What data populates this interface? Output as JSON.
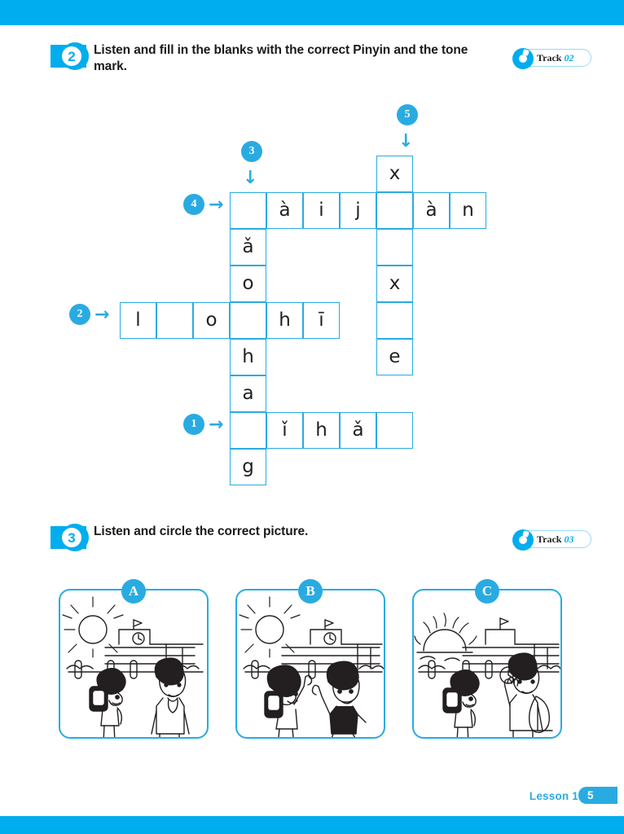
{
  "page": {
    "accent_color": "#00ADEE",
    "grid_border_color": "#29ABE2",
    "top_bar": "",
    "bottom_bar": ""
  },
  "sections": [
    {
      "number": "2",
      "title": "Listen and fill in the blanks with the correct Pinyin and the tone mark.",
      "track": {
        "label": "Track",
        "number": "02",
        "icon": "cd-disc-icon"
      }
    },
    {
      "number": "3",
      "title": "Listen and circle the correct picture.",
      "track": {
        "label": "Track",
        "number": "03",
        "icon": "cd-disc-icon"
      }
    }
  ],
  "crossword": {
    "cell_size": 45,
    "clues": [
      {
        "number": "1",
        "direction": "across",
        "arrow": "→"
      },
      {
        "number": "2",
        "direction": "across",
        "arrow": "→"
      },
      {
        "number": "3",
        "direction": "down",
        "arrow": "↓"
      },
      {
        "number": "4",
        "direction": "across",
        "arrow": "→"
      },
      {
        "number": "5",
        "direction": "down",
        "arrow": "↓"
      }
    ],
    "cells": [
      {
        "col": 7,
        "row": 0,
        "letter": "x"
      },
      {
        "col": 3,
        "row": 1,
        "letter": ""
      },
      {
        "col": 4,
        "row": 1,
        "letter": "à"
      },
      {
        "col": 5,
        "row": 1,
        "letter": "i"
      },
      {
        "col": 6,
        "row": 1,
        "letter": "j"
      },
      {
        "col": 7,
        "row": 1,
        "letter": ""
      },
      {
        "col": 8,
        "row": 1,
        "letter": "à"
      },
      {
        "col": 9,
        "row": 1,
        "letter": "n"
      },
      {
        "col": 3,
        "row": 2,
        "letter": "ǎ"
      },
      {
        "col": 7,
        "row": 2,
        "letter": ""
      },
      {
        "col": 3,
        "row": 3,
        "letter": "o"
      },
      {
        "col": 7,
        "row": 3,
        "letter": "x"
      },
      {
        "col": 0,
        "row": 4,
        "letter": "l"
      },
      {
        "col": 1,
        "row": 4,
        "letter": ""
      },
      {
        "col": 2,
        "row": 4,
        "letter": "o"
      },
      {
        "col": 3,
        "row": 4,
        "letter": ""
      },
      {
        "col": 4,
        "row": 4,
        "letter": "h"
      },
      {
        "col": 5,
        "row": 4,
        "letter": "ī"
      },
      {
        "col": 7,
        "row": 4,
        "letter": ""
      },
      {
        "col": 3,
        "row": 5,
        "letter": "h"
      },
      {
        "col": 7,
        "row": 5,
        "letter": "e"
      },
      {
        "col": 3,
        "row": 6,
        "letter": "a"
      },
      {
        "col": 3,
        "row": 7,
        "letter": ""
      },
      {
        "col": 4,
        "row": 7,
        "letter": "ǐ"
      },
      {
        "col": 5,
        "row": 7,
        "letter": "h"
      },
      {
        "col": 6,
        "row": 7,
        "letter": "ǎ"
      },
      {
        "col": 7,
        "row": 7,
        "letter": ""
      },
      {
        "col": 3,
        "row": 8,
        "letter": "g"
      }
    ]
  },
  "pictures": [
    {
      "letter": "A",
      "caption": "student-bowing-to-teacher-daytime"
    },
    {
      "letter": "B",
      "caption": "two-children-waving-greeting"
    },
    {
      "letter": "C",
      "caption": "student-bowing-man-waving-sunset"
    }
  ],
  "footer": {
    "lesson": "Lesson 1",
    "page_number": "5"
  }
}
